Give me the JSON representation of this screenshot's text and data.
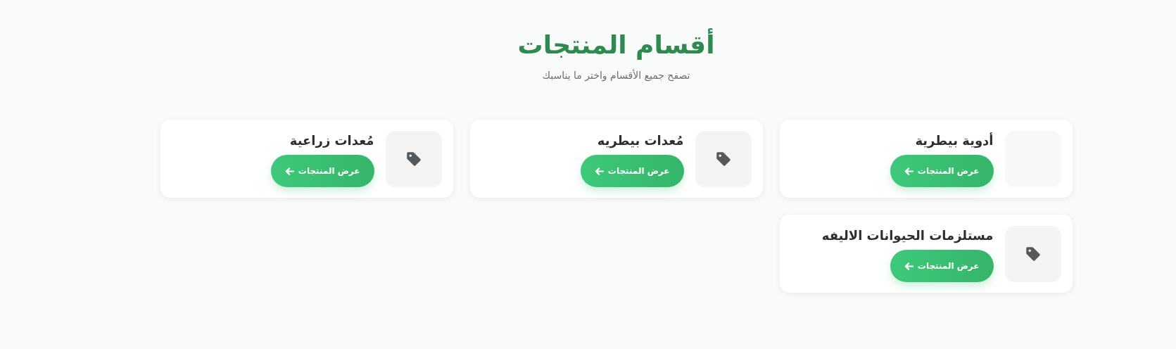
{
  "header": {
    "title": "أقسام المنتجات",
    "subtitle": "تصفح جميع الأقسام واختر ما يناسبك"
  },
  "categories": [
    {
      "name": "أدوية بيطرية",
      "kind": "empty",
      "button": "عرض المنتجات"
    },
    {
      "name": "مُعدات بيطريه",
      "kind": "tag",
      "button": "عرض المنتجات"
    },
    {
      "name": "مُعدات زراعية",
      "kind": "tag",
      "button": "عرض المنتجات"
    },
    {
      "name": "مستلزمات الحيوانات الاليفه",
      "kind": "tag",
      "button": "عرض المنتجات"
    }
  ]
}
